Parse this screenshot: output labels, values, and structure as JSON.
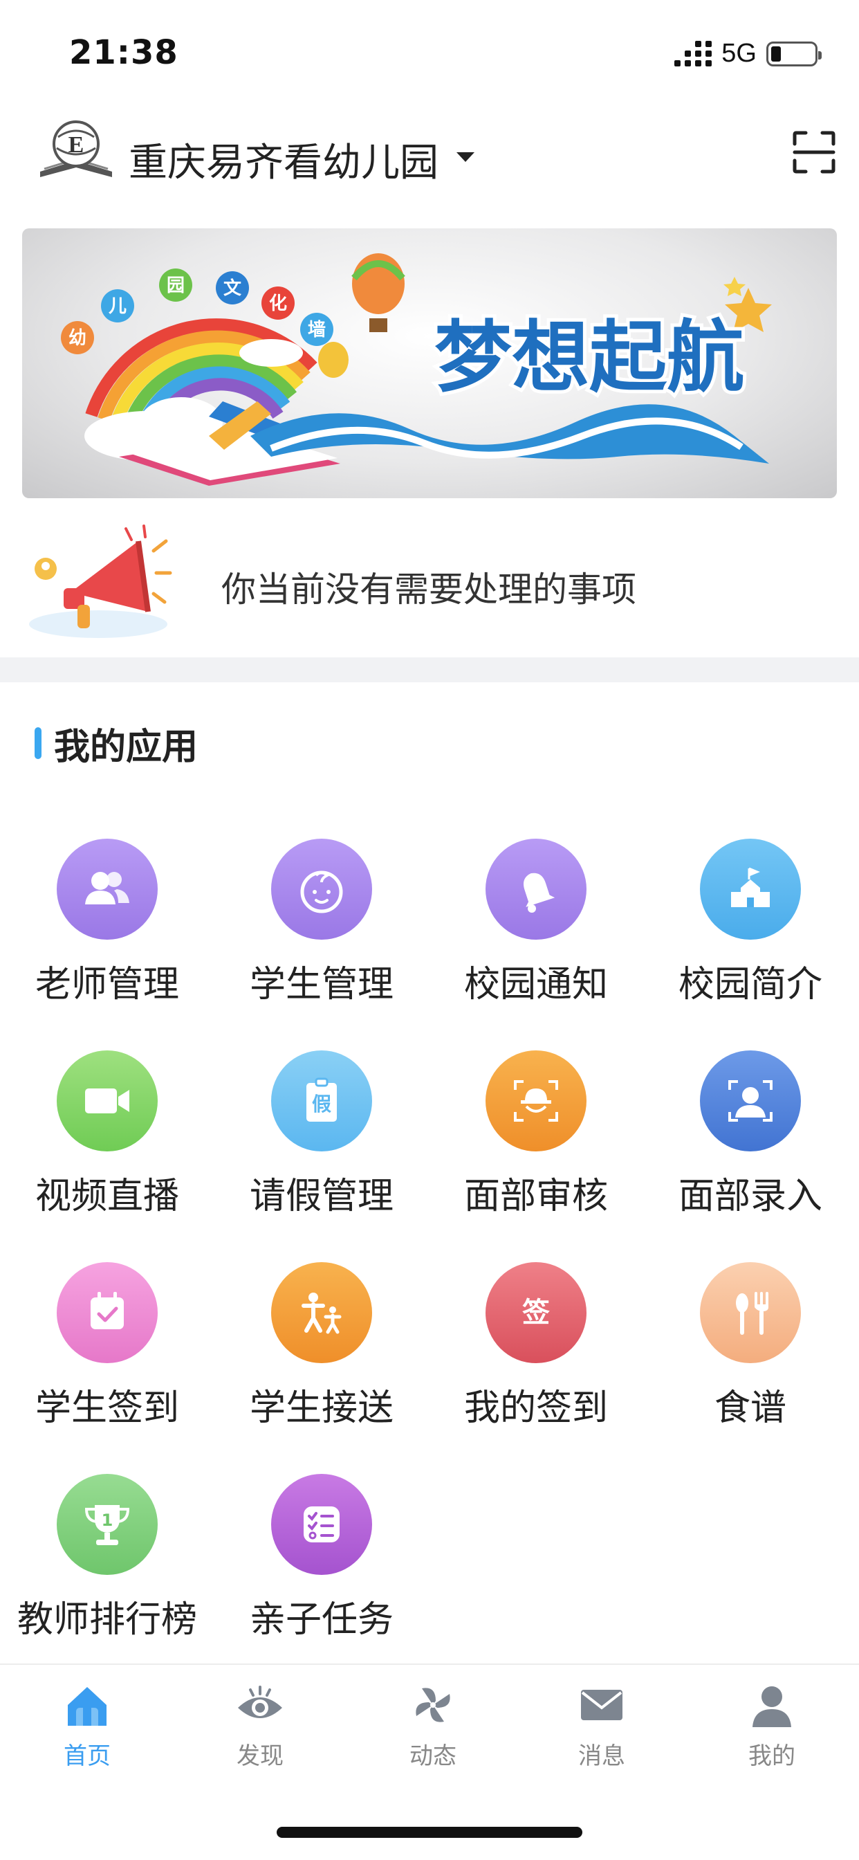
{
  "status_bar": {
    "time": "21:38",
    "network": "5G"
  },
  "header": {
    "school_name": "重庆易齐看幼儿园"
  },
  "banner": {
    "title": "梦想起航",
    "tags": [
      "幼",
      "儿",
      "园",
      "文",
      "化",
      "墙"
    ]
  },
  "notice": {
    "text": "你当前没有需要处理的事项"
  },
  "apps_section": {
    "title": "我的应用",
    "items": [
      {
        "label": "老师管理",
        "icon": "teachers-icon",
        "color": "#a98bee"
      },
      {
        "label": "学生管理",
        "icon": "baby-face-icon",
        "color": "#a98bee"
      },
      {
        "label": "校园通知",
        "icon": "bell-icon",
        "color": "#a98bee"
      },
      {
        "label": "校园简介",
        "icon": "school-building-icon",
        "color": "#5bb7f0"
      },
      {
        "label": "视频直播",
        "icon": "video-camera-icon",
        "color": "#86d769"
      },
      {
        "label": "请假管理",
        "icon": "leave-badge-icon",
        "color": "#6cc0f0"
      },
      {
        "label": "面部审核",
        "icon": "face-scan-icon",
        "color": "#f5a23a"
      },
      {
        "label": "面部录入",
        "icon": "face-id-icon",
        "color": "#4d82dc"
      },
      {
        "label": "学生签到",
        "icon": "calendar-check-icon",
        "color": "#ee8bd2"
      },
      {
        "label": "学生接送",
        "icon": "parent-child-icon",
        "color": "#f5a23a"
      },
      {
        "label": "我的签到",
        "icon": "sign-icon",
        "color": "#e56570",
        "glyph": "签"
      },
      {
        "label": "食谱",
        "icon": "spoon-fork-icon",
        "color": "#f9c19a"
      },
      {
        "label": "教师排行榜",
        "icon": "trophy-icon",
        "color": "#7dd07b",
        "glyph": "1"
      },
      {
        "label": "亲子任务",
        "icon": "task-list-icon",
        "color": "#b763d8"
      }
    ]
  },
  "tabbar": {
    "tabs": [
      {
        "label": "首页",
        "icon": "home-icon",
        "active": true
      },
      {
        "label": "发现",
        "icon": "eye-icon",
        "active": false
      },
      {
        "label": "动态",
        "icon": "pinwheel-icon",
        "active": false
      },
      {
        "label": "消息",
        "icon": "mail-icon",
        "active": false
      },
      {
        "label": "我的",
        "icon": "person-icon",
        "active": false
      }
    ]
  },
  "colors": {
    "accent": "#3a9df0",
    "divider": "#f1f2f4"
  }
}
